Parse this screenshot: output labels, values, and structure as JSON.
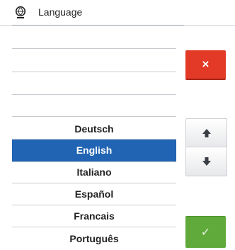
{
  "header": {
    "title": "Language",
    "icon": "globe-speaker-icon"
  },
  "languages": [
    "Deutsch",
    "English",
    "Italiano",
    "Español",
    "Francais",
    "Português"
  ],
  "selected_language": "English",
  "buttons": {
    "close": "×",
    "up": "▲",
    "down": "▼",
    "confirm": "✓"
  },
  "colors": {
    "selection": "#2164b3",
    "close": "#e23a27",
    "confirm": "#5faa3a"
  }
}
